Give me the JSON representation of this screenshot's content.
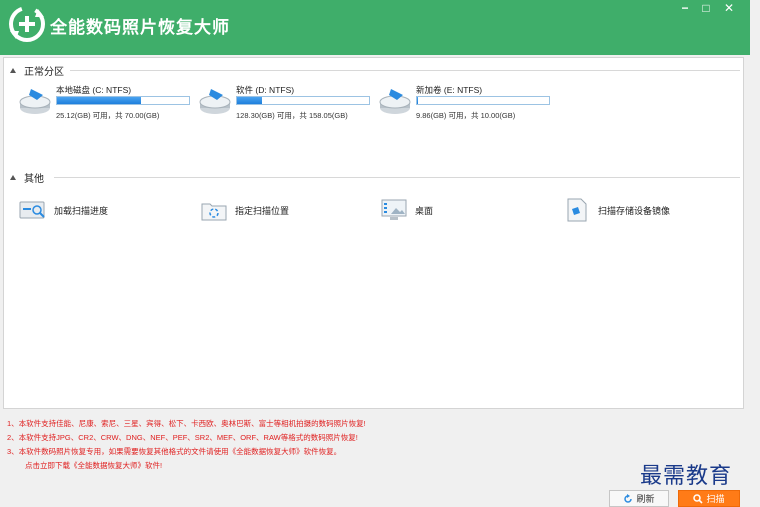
{
  "app": {
    "title": "全能数码照片恢复大师"
  },
  "window_controls": {
    "minimize": "−",
    "maximize": "□",
    "close": "✕"
  },
  "sections": {
    "normal": "正常分区",
    "other": "其他"
  },
  "drives": [
    {
      "name": "本地磁盘 (C: NTFS)",
      "size_text": "25.12(GB) 可用，共 70.00(GB)",
      "used_fraction": 0.64,
      "icon": "hard-drive-icon"
    },
    {
      "name": "软件 (D: NTFS)",
      "size_text": "128.30(GB) 可用，共 158.05(GB)",
      "used_fraction": 0.19,
      "icon": "hard-drive-icon"
    },
    {
      "name": "新加卷 (E: NTFS)",
      "size_text": "9.86(GB) 可用，共 10.00(GB)",
      "used_fraction": 0.01,
      "icon": "hard-drive-icon"
    }
  ],
  "options": [
    {
      "label": "加载扫描进度",
      "icon": "load-scan-progress-icon"
    },
    {
      "label": "指定扫描位置",
      "icon": "scan-location-icon"
    },
    {
      "label": "桌面",
      "icon": "desktop-icon"
    },
    {
      "label": "扫描存储设备镜像",
      "icon": "device-image-icon"
    }
  ],
  "notes": [
    "1、本软件支持佳能、尼康、索尼、三星、宾得、松下、卡西欧、奥林巴斯、富士等相机拍摄的数码照片恢复!",
    "2、本软件支持JPG、CR2、CRW、DNG、NEF、PEF、SR2、MEF、ORF、RAW等格式的数码照片恢复!",
    "3、本软件数码照片恢复专用，如果需要恢复其他格式的文件请使用《全能数据恢复大师》软件恢复。",
    "点击立即下载《全能数据恢复大师》软件!"
  ],
  "buttons": {
    "refresh": "刷新",
    "scan": "扫描"
  },
  "watermark": "最需教育",
  "colors": {
    "titlebar": "#3fae6a",
    "progress": "#1e7fdc",
    "scan_button": "#ff7b17",
    "notes": "#e02020"
  }
}
